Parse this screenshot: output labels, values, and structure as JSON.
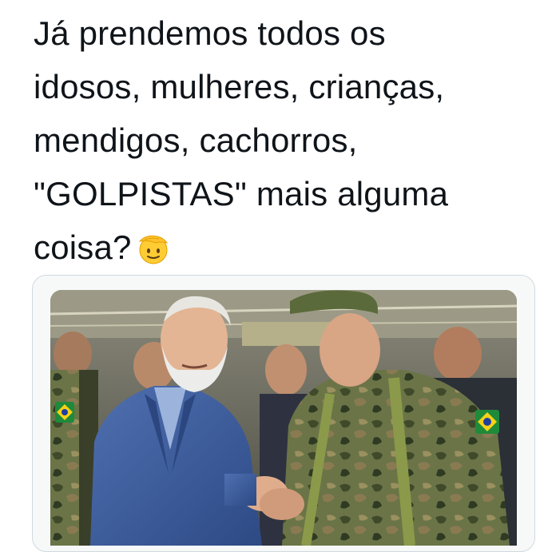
{
  "tweet": {
    "lines": [
      "Já prendemos todos os",
      "idosos, mulheres, crianças,",
      "mendigos, cachorros,",
      "\"GOLPISTAS\" mais alguma",
      "coisa?"
    ],
    "emoji": "saluting-face-emoji"
  },
  "media": {
    "icons": [
      "brazil-flag-patch-icon"
    ],
    "colors": {
      "suit": "#3d5d9c",
      "camo_base": "#5e6b3f",
      "beret": "#5b6a3a",
      "background": "#6d6a5a"
    }
  }
}
